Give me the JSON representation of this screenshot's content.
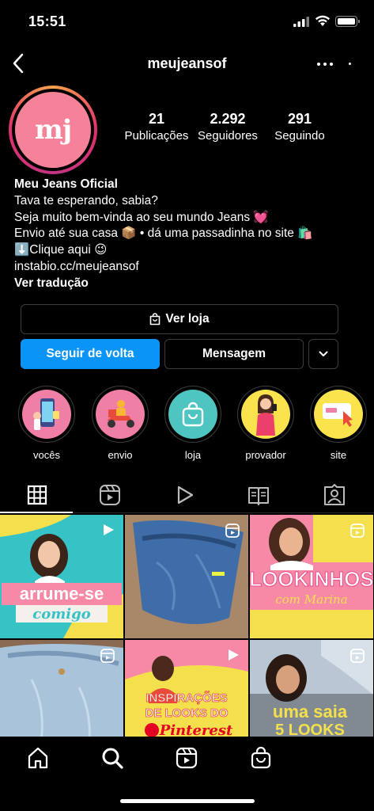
{
  "status": {
    "time": "15:51"
  },
  "header": {
    "username": "meujeansof"
  },
  "profile": {
    "avatar_text": "mj",
    "stats": [
      {
        "value": "21",
        "label": "Publicações"
      },
      {
        "value": "2.292",
        "label": "Seguidores"
      },
      {
        "value": "291",
        "label": "Seguindo"
      }
    ]
  },
  "bio": {
    "name": "Meu Jeans Oficial",
    "line1": "Tava te esperando, sabia?",
    "line2": "Seja muito bem-vinda ao seu mundo Jeans 💓",
    "line3": "Envio até sua casa 📦 • dá uma passadinha no site 🛍️",
    "line4": "⬇️Clique aqui 😉",
    "link": "instabio.cc/meujeansof",
    "translate": "Ver tradução"
  },
  "buttons": {
    "shop": "Ver loja",
    "follow_back": "Seguir de volta",
    "message": "Mensagem"
  },
  "highlights": [
    {
      "label": "vocês",
      "icon": "phone-shopping-icon"
    },
    {
      "label": "envio",
      "icon": "delivery-scooter-icon"
    },
    {
      "label": "loja",
      "icon": "shopping-bag-icon"
    },
    {
      "label": "provador",
      "icon": "mirror-selfie-icon"
    },
    {
      "label": "site",
      "icon": "browser-cursor-icon"
    }
  ],
  "tabs": [
    "grid-icon",
    "reels-icon",
    "video-icon",
    "guides-icon",
    "tagged-icon"
  ],
  "posts": [
    {
      "text1": "arrume-se",
      "text2": "comigo"
    },
    {
      "text1": ""
    },
    {
      "text1": "LOOKINHOS",
      "text2": "com Marina"
    },
    {
      "text1": ""
    },
    {
      "text1": "INSPIRAÇÕES",
      "text2": "DE LOOKS DO",
      "text3": "Pinterest"
    },
    {
      "text1": "uma saia",
      "text2": "5 LOOKS"
    }
  ],
  "colors": {
    "accent_blue": "#0a95f6",
    "brand_pink": "#f6829a"
  }
}
